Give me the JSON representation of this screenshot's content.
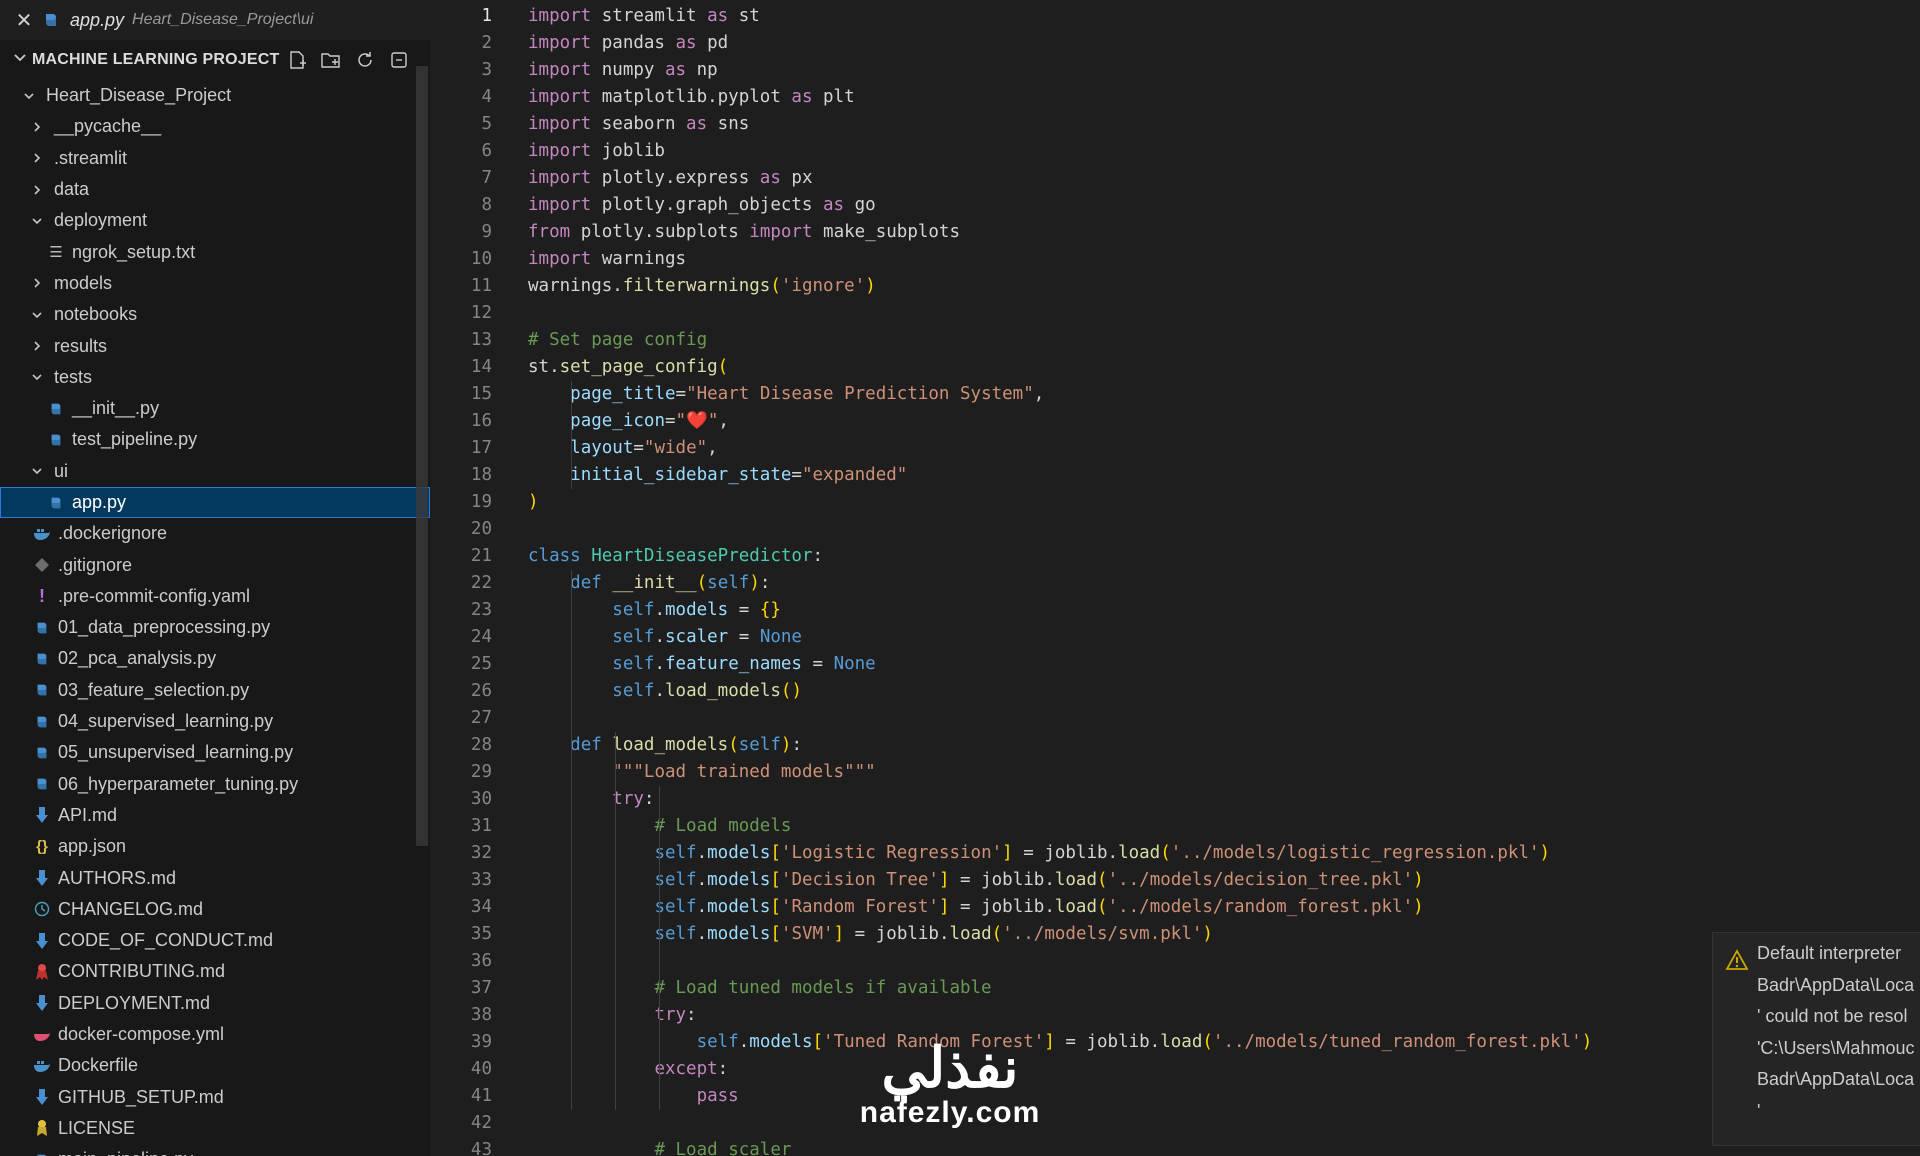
{
  "open_editor": {
    "file": "app.py",
    "path": "Heart_Disease_Project\\ui"
  },
  "explorer": {
    "project_title": "MACHINE LEARNING PROJECT",
    "items": [
      {
        "label": "Heart_Disease_Project",
        "kind": "folder-open",
        "depth": 0
      },
      {
        "label": "__pycache__",
        "kind": "folder",
        "depth": 1
      },
      {
        "label": ".streamlit",
        "kind": "folder",
        "depth": 1
      },
      {
        "label": "data",
        "kind": "folder",
        "depth": 1
      },
      {
        "label": "deployment",
        "kind": "folder-open",
        "depth": 1
      },
      {
        "label": "ngrok_setup.txt",
        "kind": "txt",
        "depth": 2
      },
      {
        "label": "models",
        "kind": "folder",
        "depth": 1
      },
      {
        "label": "notebooks",
        "kind": "folder-open",
        "depth": 1
      },
      {
        "label": "results",
        "kind": "folder",
        "depth": 1
      },
      {
        "label": "tests",
        "kind": "folder-open",
        "depth": 1
      },
      {
        "label": "__init__.py",
        "kind": "py",
        "depth": 2
      },
      {
        "label": "test_pipeline.py",
        "kind": "py",
        "depth": 2
      },
      {
        "label": "ui",
        "kind": "folder-open",
        "depth": 1
      },
      {
        "label": "app.py",
        "kind": "py",
        "depth": 2,
        "selected": true
      },
      {
        "label": ".dockerignore",
        "kind": "docker",
        "depth": 1
      },
      {
        "label": ".gitignore",
        "kind": "git",
        "depth": 1
      },
      {
        "label": ".pre-commit-config.yaml",
        "kind": "yaml",
        "depth": 1
      },
      {
        "label": "01_data_preprocessing.py",
        "kind": "py",
        "depth": 1
      },
      {
        "label": "02_pca_analysis.py",
        "kind": "py",
        "depth": 1
      },
      {
        "label": "03_feature_selection.py",
        "kind": "py",
        "depth": 1
      },
      {
        "label": "04_supervised_learning.py",
        "kind": "py",
        "depth": 1
      },
      {
        "label": "05_unsupervised_learning.py",
        "kind": "py",
        "depth": 1
      },
      {
        "label": "06_hyperparameter_tuning.py",
        "kind": "py",
        "depth": 1
      },
      {
        "label": "API.md",
        "kind": "md",
        "depth": 1
      },
      {
        "label": "app.json",
        "kind": "json",
        "depth": 1
      },
      {
        "label": "AUTHORS.md",
        "kind": "md",
        "depth": 1
      },
      {
        "label": "CHANGELOG.md",
        "kind": "changelog",
        "depth": 1
      },
      {
        "label": "CODE_OF_CONDUCT.md",
        "kind": "md",
        "depth": 1
      },
      {
        "label": "CONTRIBUTING.md",
        "kind": "contrib",
        "depth": 1
      },
      {
        "label": "DEPLOYMENT.md",
        "kind": "md",
        "depth": 1
      },
      {
        "label": "docker-compose.yml",
        "kind": "compose",
        "depth": 1
      },
      {
        "label": "Dockerfile",
        "kind": "docker",
        "depth": 1
      },
      {
        "label": "GITHUB_SETUP.md",
        "kind": "md",
        "depth": 1
      },
      {
        "label": "LICENSE",
        "kind": "license",
        "depth": 1
      },
      {
        "label": "main_pipeline.py",
        "kind": "py",
        "depth": 1
      }
    ]
  },
  "editor": {
    "current_line": 1,
    "lines": [
      [
        [
          "k",
          "import"
        ],
        [
          "p",
          " streamlit "
        ],
        [
          "k",
          "as"
        ],
        [
          "p",
          " st"
        ]
      ],
      [
        [
          "k",
          "import"
        ],
        [
          "p",
          " pandas "
        ],
        [
          "k",
          "as"
        ],
        [
          "p",
          " pd"
        ]
      ],
      [
        [
          "k",
          "import"
        ],
        [
          "p",
          " numpy "
        ],
        [
          "k",
          "as"
        ],
        [
          "p",
          " np"
        ]
      ],
      [
        [
          "k",
          "import"
        ],
        [
          "p",
          " matplotlib.pyplot "
        ],
        [
          "k",
          "as"
        ],
        [
          "p",
          " plt"
        ]
      ],
      [
        [
          "k",
          "import"
        ],
        [
          "p",
          " seaborn "
        ],
        [
          "k",
          "as"
        ],
        [
          "p",
          " sns"
        ]
      ],
      [
        [
          "k",
          "import"
        ],
        [
          "p",
          " joblib"
        ]
      ],
      [
        [
          "k",
          "import"
        ],
        [
          "p",
          " plotly.express "
        ],
        [
          "k",
          "as"
        ],
        [
          "p",
          " px"
        ]
      ],
      [
        [
          "k",
          "import"
        ],
        [
          "p",
          " plotly.graph_objects "
        ],
        [
          "k",
          "as"
        ],
        [
          "p",
          " go"
        ]
      ],
      [
        [
          "k",
          "from"
        ],
        [
          "p",
          " plotly.subplots "
        ],
        [
          "k",
          "import"
        ],
        [
          "p",
          " make_subplots"
        ]
      ],
      [
        [
          "k",
          "import"
        ],
        [
          "p",
          " warnings"
        ]
      ],
      [
        [
          "p",
          "warnings."
        ],
        [
          "f",
          "filterwarnings"
        ],
        [
          "br1",
          "("
        ],
        [
          "s",
          "'ignore'"
        ],
        [
          "br1",
          ")"
        ]
      ],
      [],
      [
        [
          "c",
          "# Set page config"
        ]
      ],
      [
        [
          "p",
          "st."
        ],
        [
          "f",
          "set_page_config"
        ],
        [
          "br1",
          "("
        ]
      ],
      [
        [
          "p",
          "    "
        ],
        [
          "v",
          "page_title"
        ],
        [
          "p",
          "="
        ],
        [
          "s",
          "\"Heart Disease Prediction System\""
        ],
        [
          "p",
          ","
        ]
      ],
      [
        [
          "p",
          "    "
        ],
        [
          "v",
          "page_icon"
        ],
        [
          "p",
          "="
        ],
        [
          "s",
          "\"❤️\""
        ],
        [
          "p",
          ","
        ]
      ],
      [
        [
          "p",
          "    "
        ],
        [
          "v",
          "layout"
        ],
        [
          "p",
          "="
        ],
        [
          "s",
          "\"wide\""
        ],
        [
          "p",
          ","
        ]
      ],
      [
        [
          "p",
          "    "
        ],
        [
          "v",
          "initial_sidebar_state"
        ],
        [
          "p",
          "="
        ],
        [
          "s",
          "\"expanded\""
        ]
      ],
      [
        [
          "br1",
          ")"
        ]
      ],
      [],
      [
        [
          "kb",
          "class"
        ],
        [
          "p",
          " "
        ],
        [
          "cl",
          "HeartDiseasePredictor"
        ],
        [
          "p",
          ":"
        ]
      ],
      [
        [
          "p",
          "    "
        ],
        [
          "kb",
          "def"
        ],
        [
          "p",
          " "
        ],
        [
          "f",
          "__init__"
        ],
        [
          "br1",
          "("
        ],
        [
          "sf",
          "self"
        ],
        [
          "br1",
          ")"
        ],
        [
          "p",
          ":"
        ]
      ],
      [
        [
          "p",
          "        "
        ],
        [
          "sf",
          "self"
        ],
        [
          "p",
          "."
        ],
        [
          "v",
          "models"
        ],
        [
          "p",
          " = "
        ],
        [
          "br1",
          "{}"
        ]
      ],
      [
        [
          "p",
          "        "
        ],
        [
          "sf",
          "self"
        ],
        [
          "p",
          "."
        ],
        [
          "v",
          "scaler"
        ],
        [
          "p",
          " = "
        ],
        [
          "kb",
          "None"
        ]
      ],
      [
        [
          "p",
          "        "
        ],
        [
          "sf",
          "self"
        ],
        [
          "p",
          "."
        ],
        [
          "v",
          "feature_names"
        ],
        [
          "p",
          " = "
        ],
        [
          "kb",
          "None"
        ]
      ],
      [
        [
          "p",
          "        "
        ],
        [
          "sf",
          "self"
        ],
        [
          "p",
          "."
        ],
        [
          "f",
          "load_models"
        ],
        [
          "br1",
          "()"
        ]
      ],
      [],
      [
        [
          "p",
          "    "
        ],
        [
          "kb",
          "def"
        ],
        [
          "p",
          " "
        ],
        [
          "f",
          "load_models"
        ],
        [
          "br1",
          "("
        ],
        [
          "sf",
          "self"
        ],
        [
          "br1",
          ")"
        ],
        [
          "p",
          ":"
        ]
      ],
      [
        [
          "p",
          "        "
        ],
        [
          "s",
          "\"\"\"Load trained models\"\"\""
        ]
      ],
      [
        [
          "p",
          "        "
        ],
        [
          "k",
          "try"
        ],
        [
          "p",
          ":"
        ]
      ],
      [
        [
          "p",
          "            "
        ],
        [
          "c",
          "# Load models"
        ]
      ],
      [
        [
          "p",
          "            "
        ],
        [
          "sf",
          "self"
        ],
        [
          "p",
          "."
        ],
        [
          "v",
          "models"
        ],
        [
          "br1",
          "["
        ],
        [
          "s",
          "'Logistic Regression'"
        ],
        [
          "br1",
          "]"
        ],
        [
          "p",
          " = joblib."
        ],
        [
          "f",
          "load"
        ],
        [
          "br1",
          "("
        ],
        [
          "s",
          "'../models/logistic_regression.pkl'"
        ],
        [
          "br1",
          ")"
        ]
      ],
      [
        [
          "p",
          "            "
        ],
        [
          "sf",
          "self"
        ],
        [
          "p",
          "."
        ],
        [
          "v",
          "models"
        ],
        [
          "br1",
          "["
        ],
        [
          "s",
          "'Decision Tree'"
        ],
        [
          "br1",
          "]"
        ],
        [
          "p",
          " = joblib."
        ],
        [
          "f",
          "load"
        ],
        [
          "br1",
          "("
        ],
        [
          "s",
          "'../models/decision_tree.pkl'"
        ],
        [
          "br1",
          ")"
        ]
      ],
      [
        [
          "p",
          "            "
        ],
        [
          "sf",
          "self"
        ],
        [
          "p",
          "."
        ],
        [
          "v",
          "models"
        ],
        [
          "br1",
          "["
        ],
        [
          "s",
          "'Random Forest'"
        ],
        [
          "br1",
          "]"
        ],
        [
          "p",
          " = joblib."
        ],
        [
          "f",
          "load"
        ],
        [
          "br1",
          "("
        ],
        [
          "s",
          "'../models/random_forest.pkl'"
        ],
        [
          "br1",
          ")"
        ]
      ],
      [
        [
          "p",
          "            "
        ],
        [
          "sf",
          "self"
        ],
        [
          "p",
          "."
        ],
        [
          "v",
          "models"
        ],
        [
          "br1",
          "["
        ],
        [
          "s",
          "'SVM'"
        ],
        [
          "br1",
          "]"
        ],
        [
          "p",
          " = joblib."
        ],
        [
          "f",
          "load"
        ],
        [
          "br1",
          "("
        ],
        [
          "s",
          "'../models/svm.pkl'"
        ],
        [
          "br1",
          ")"
        ]
      ],
      [],
      [
        [
          "p",
          "            "
        ],
        [
          "c",
          "# Load tuned models if available"
        ]
      ],
      [
        [
          "p",
          "            "
        ],
        [
          "k",
          "try"
        ],
        [
          "p",
          ":"
        ]
      ],
      [
        [
          "p",
          "                "
        ],
        [
          "sf",
          "self"
        ],
        [
          "p",
          "."
        ],
        [
          "v",
          "models"
        ],
        [
          "br1",
          "["
        ],
        [
          "s",
          "'Tuned Random Forest'"
        ],
        [
          "br1",
          "]"
        ],
        [
          "p",
          " = joblib."
        ],
        [
          "f",
          "load"
        ],
        [
          "br1",
          "("
        ],
        [
          "s",
          "'../models/tuned_random_forest.pkl'"
        ],
        [
          "br1",
          ")"
        ]
      ],
      [
        [
          "p",
          "            "
        ],
        [
          "k",
          "except"
        ],
        [
          "p",
          ":"
        ]
      ],
      [
        [
          "p",
          "                "
        ],
        [
          "k",
          "pass"
        ]
      ],
      [],
      [
        [
          "p",
          "            "
        ],
        [
          "c",
          "# Load scaler"
        ]
      ]
    ]
  },
  "notification": {
    "lines": [
      "Default interpreter",
      "Badr\\AppData\\Loca",
      "' could not be resol",
      "'C:\\Users\\Mahmouc",
      "Badr\\AppData\\Loca",
      "'"
    ]
  },
  "watermark": {
    "arabic": "نفذلي",
    "latin": "nafezly.com"
  }
}
